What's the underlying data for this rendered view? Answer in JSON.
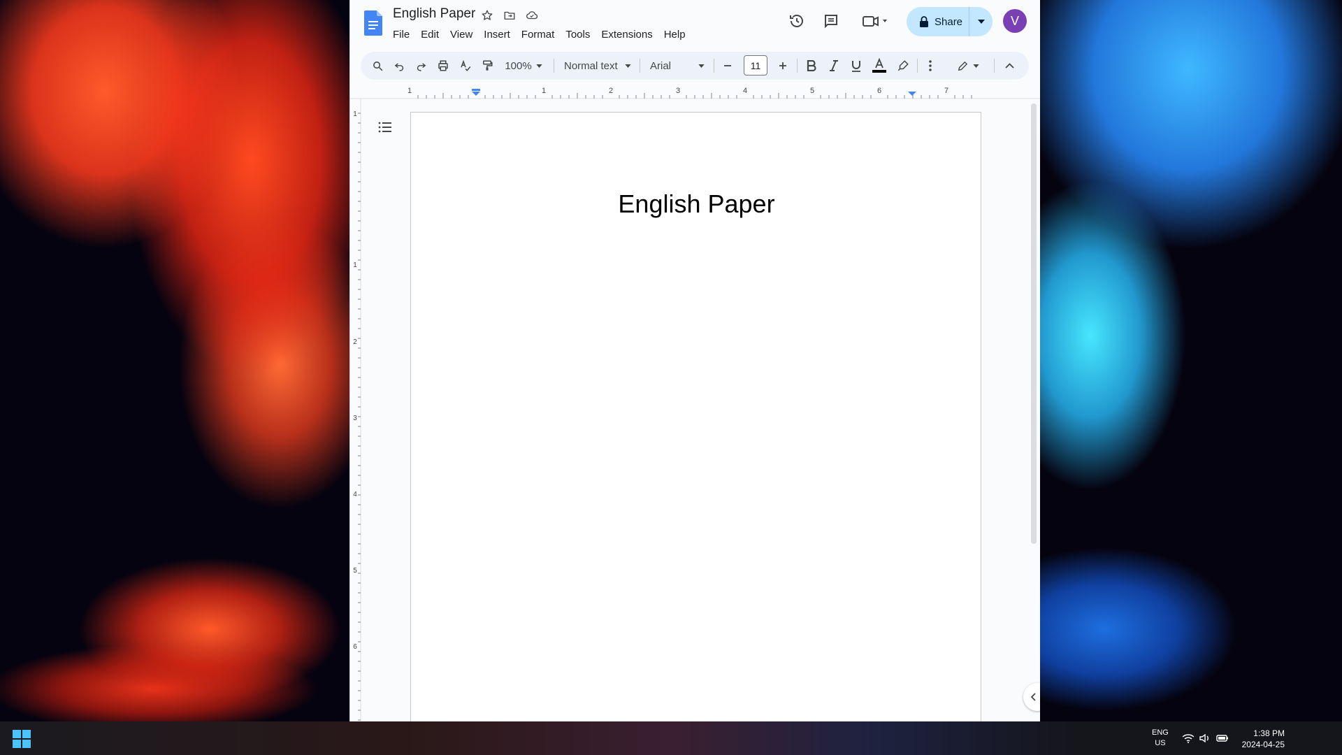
{
  "document": {
    "title": "English Paper",
    "heading": "English Paper"
  },
  "menubar": {
    "items": [
      "File",
      "Edit",
      "View",
      "Insert",
      "Format",
      "Tools",
      "Extensions",
      "Help"
    ]
  },
  "share": {
    "label": "Share"
  },
  "account": {
    "initial": "V",
    "avatar_color": "#7b3fb5"
  },
  "toolbar": {
    "zoom": "100%",
    "style": "Normal text",
    "font": "Arial",
    "font_size": "11"
  },
  "ruler": {
    "marks": [
      "1",
      "1",
      "2",
      "3",
      "4",
      "5",
      "6",
      "7"
    ]
  },
  "vruler": {
    "marks": [
      "1",
      "1",
      "2",
      "3",
      "4",
      "5",
      "6"
    ]
  },
  "taskbar": {
    "lang_primary": "ENG",
    "lang_secondary": "US",
    "time": "1:38 PM",
    "date": "2024-04-25"
  },
  "colors": {
    "share_bg": "#c2e7ff",
    "toolbar_bg": "#edf2fa",
    "accent_blue": "#4285f4"
  }
}
